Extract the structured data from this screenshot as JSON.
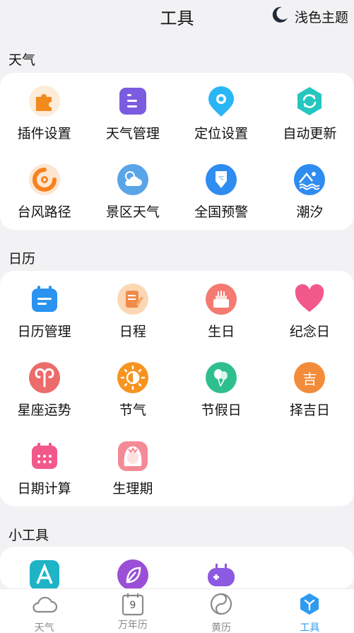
{
  "header": {
    "title": "工具",
    "theme_label": "浅色主题"
  },
  "sections": [
    {
      "title": "天气",
      "items": [
        {
          "label": "插件设置",
          "icon": "puzzle-icon"
        },
        {
          "label": "天气管理",
          "icon": "list-doc-icon"
        },
        {
          "label": "定位设置",
          "icon": "location-pin-icon"
        },
        {
          "label": "自动更新",
          "icon": "refresh-icon"
        },
        {
          "label": "台风路径",
          "icon": "typhoon-icon"
        },
        {
          "label": "景区天气",
          "icon": "sun-cloud-icon"
        },
        {
          "label": "全国预警",
          "icon": "warning-shield-icon"
        },
        {
          "label": "潮汐",
          "icon": "tide-icon"
        }
      ]
    },
    {
      "title": "日历",
      "items": [
        {
          "label": "日历管理",
          "icon": "calendar-icon"
        },
        {
          "label": "日程",
          "icon": "notepad-icon"
        },
        {
          "label": "生日",
          "icon": "cake-icon"
        },
        {
          "label": "纪念日",
          "icon": "heart-icon"
        },
        {
          "label": "星座运势",
          "icon": "aries-icon"
        },
        {
          "label": "节气",
          "icon": "half-sun-icon"
        },
        {
          "label": "节假日",
          "icon": "balloon-icon"
        },
        {
          "label": "择吉日",
          "icon": "ji-character-icon",
          "glyph": "吉"
        },
        {
          "label": "日期计算",
          "icon": "calendar-grid-icon"
        },
        {
          "label": "生理期",
          "icon": "girl-face-icon"
        }
      ]
    },
    {
      "title": "小工具",
      "items": [
        {
          "label": "",
          "icon": "font-a-icon"
        },
        {
          "label": "",
          "icon": "leaf-icon"
        },
        {
          "label": "",
          "icon": "gamepad-icon"
        }
      ]
    }
  ],
  "tabbar": [
    {
      "label": "天气",
      "icon": "cloud-outline-icon",
      "active": false
    },
    {
      "label": "万年历",
      "icon": "calendar-day-icon",
      "active": false,
      "day": "9"
    },
    {
      "label": "黄历",
      "icon": "taiji-icon",
      "active": false
    },
    {
      "label": "工具",
      "icon": "tools-hexagon-icon",
      "active": true
    }
  ],
  "colors": {
    "accent": "#2e9bf0",
    "page_bg": "#f2f2f4",
    "card_bg": "#ffffff"
  }
}
